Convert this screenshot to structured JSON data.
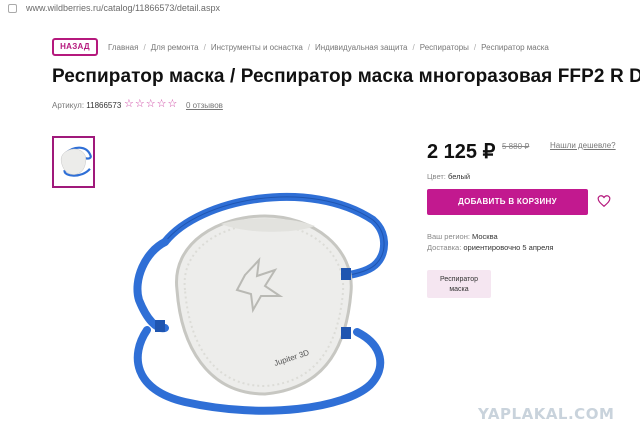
{
  "browser": {
    "url": "www.wildberries.ru/catalog/11866573/detail.aspx"
  },
  "nav": {
    "back_label": "НАЗАД",
    "breadcrumbs": [
      "Главная",
      "Для ремонта",
      "Инструменты и оснастка",
      "Индивидуальная защита",
      "Респираторы",
      "Респиратор маска"
    ]
  },
  "product": {
    "title": "Респиратор маска / Респиратор маска многоразовая FFP2 R D",
    "article_label": "Артикул:",
    "article_value": "11866573",
    "rating_stars": "☆☆☆☆☆",
    "reviews_label": "0 отзывов",
    "price": "2 125 ₽",
    "old_price": "5 880 ₽",
    "cheaper_link": "Нашли дешевле?",
    "color_label": "Цвет:",
    "color_value": "белый",
    "cart_button": "ДОБАВИТЬ В КОРЗИНУ",
    "region_label": "Ваш регион:",
    "region_value": "Москва",
    "delivery_label": "Доставка:",
    "delivery_value": "ориентировочно 5 апреля",
    "tag_line1": "Респиратор",
    "tag_line2": "маска",
    "mask_print": "Jupiter 3D"
  },
  "watermark": "YAPLAKAL.COM",
  "colors": {
    "accent": "#c2198f",
    "strap": "#2f6fd6"
  }
}
